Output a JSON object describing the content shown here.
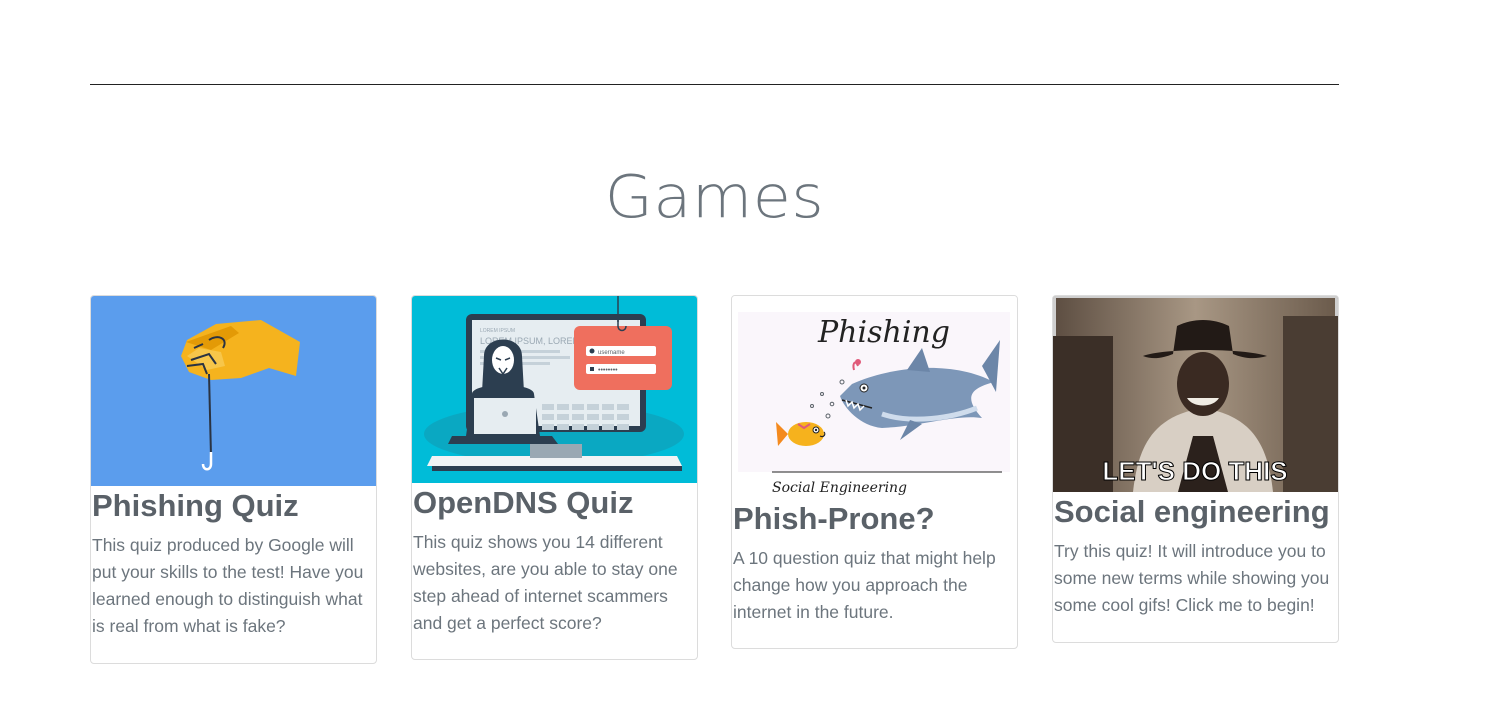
{
  "section": {
    "title": "Games"
  },
  "cards": [
    {
      "title": "Phishing Quiz",
      "text": "This quiz produced by Google will put your skills to the test! Have you learned enough to distinguish what is real from what is fake?",
      "image_icon": "hand-fishing-hook-icon",
      "image_bg": "#5b9ded"
    },
    {
      "title": "OpenDNS Quiz",
      "text": "This quiz shows you 14 different websites, are you able to stay one step ahead of internet scammers and get a perfect score?",
      "image_icon": "hacker-laptop-login-icon",
      "image_bg": "#00bcd8",
      "image_lines": {
        "username": "username",
        "password": "••••••••",
        "screen_text_1": "LOREM IPSUM",
        "screen_text_2": "LOREM IPSUM, LOREM IP"
      }
    },
    {
      "title": "Phish-Prone?",
      "text": "A 10 question quiz that might help change how you approach the internet in the future.",
      "image_icon": "shark-chasing-fish-icon",
      "image_caption_top": "Phishing",
      "image_caption_bottom": "Social Engineering"
    },
    {
      "title": "Social engineering",
      "text": "Try this quiz! It will introduce you to some new terms while showing you some cool gifs! Click me to begin!",
      "image_icon": "cowboy-gif-icon",
      "image_caption": "LET'S DO THIS"
    }
  ]
}
